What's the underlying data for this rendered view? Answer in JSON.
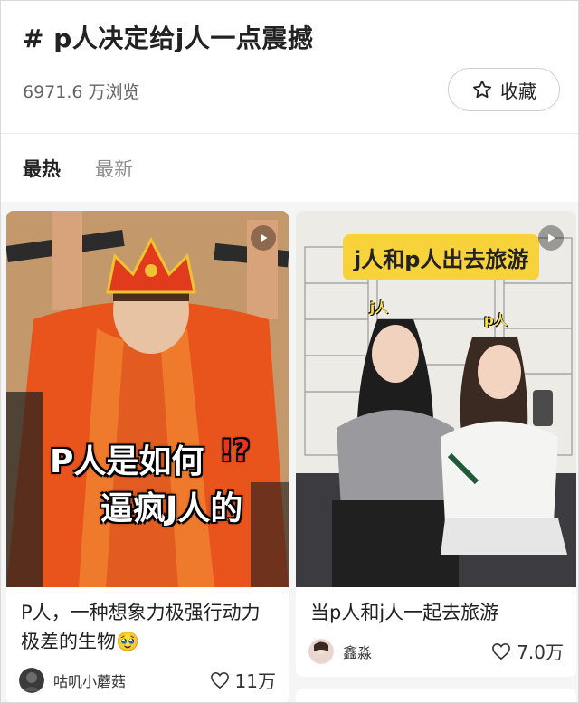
{
  "header": {
    "topic_title": "# p人决定给j人一点震撼",
    "views": "6971.6 万浏览",
    "favorite_label": "收藏"
  },
  "tabs": [
    {
      "label": "最热",
      "active": true
    },
    {
      "label": "最新",
      "active": false
    }
  ],
  "posts": [
    {
      "cover_overlay_line1": "P人是如何",
      "cover_overlay_marks": "!?",
      "cover_overlay_line2": "逼疯J人的",
      "title": "P人，一种想象力极强行动力极差的生物🥹",
      "author": "咕叽小蘑菇",
      "likes": "11万"
    },
    {
      "cover_overlay_banner": "j人和p人出去旅游",
      "cover_label_left": "j人",
      "cover_label_right": "p人",
      "title": "当p人和j人一起去旅游",
      "author": "鑫淼",
      "likes": "7.0万"
    }
  ],
  "colors": {
    "accent_yellow": "#f7d23b",
    "robe_orange": "#e8541c",
    "text_primary": "#222222",
    "text_secondary": "#8e8e8e"
  },
  "icons": [
    "star-icon",
    "heart-icon",
    "play-icon"
  ]
}
